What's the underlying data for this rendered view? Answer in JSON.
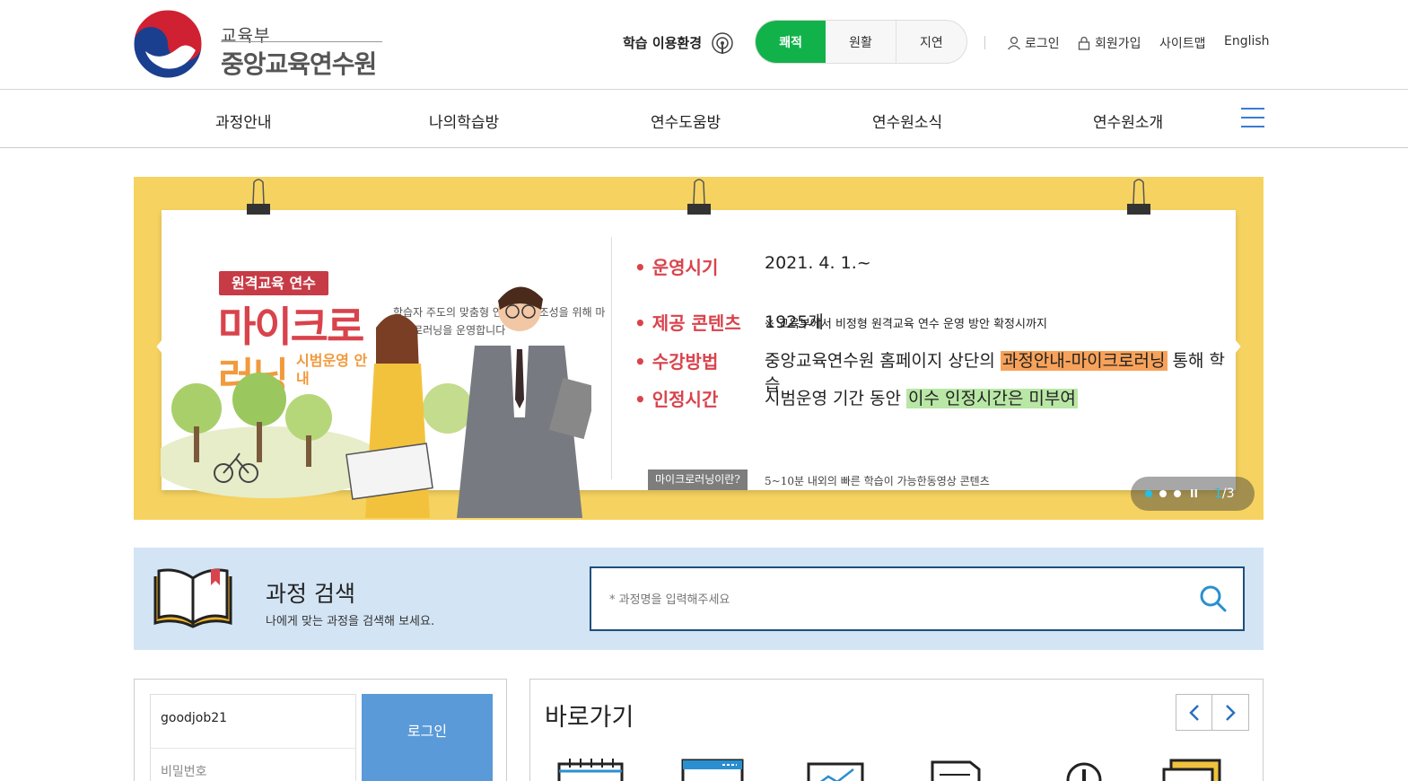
{
  "header": {
    "logo_small": "교육부",
    "logo_big": "중앙교육연수원",
    "env_label": "학습 이용환경",
    "env_options": [
      "쾌적",
      "원활",
      "지연"
    ],
    "env_selected": "쾌적",
    "util": {
      "login": "로그인",
      "signup": "회원가입",
      "sitemap": "사이트맵",
      "english": "English"
    }
  },
  "gnb": {
    "items": [
      "과정안내",
      "나의학습방",
      "연수도움방",
      "연수원소식",
      "연수원소개"
    ]
  },
  "banner": {
    "badge": "원격교육 연수",
    "title_line1": "마이크로",
    "title_line2": "러닝",
    "title_sub": "시범운영 안내",
    "intro": "학습자 주도의 맞춤형 연수 환경 조성을 위해 마이크로러닝을 운영합니다",
    "rows": [
      {
        "label": "운영시기",
        "value": "2021. 4. 1.~"
      },
      {
        "label": "제공 콘텐츠",
        "value": "1925개"
      },
      {
        "label": "수강방법",
        "value_pre": "중앙교육연수원 홈페이지 상단의 ",
        "value_hl": "과정안내-마이크로러닝",
        "value_post": " 통해 학습"
      },
      {
        "label": "인정시간",
        "value_pre": "시범운영 기간 동안 ",
        "value_hl": "이수 인정시간은 미부여"
      }
    ],
    "note": "※ 교육부에서 비정형 원격교육 연수 운영 방안 확정시까지",
    "micro_tag": "마이크로러닝이란?",
    "micro_desc": "5~10분 내외의 빠른 학습이 가능한동영상 콘텐츠",
    "pager": {
      "current": "1",
      "total": "/3",
      "pause": "II"
    },
    "colors": {
      "bg": "#f6d360",
      "red": "#d9434c",
      "orange": "#f29a3c"
    }
  },
  "search": {
    "title": "과정 검색",
    "subtitle": "나에게 맞는 과정을 검색해 보세요.",
    "placeholder": "* 과정명을 입력해주세요"
  },
  "login": {
    "id_value": "goodjob21",
    "pw_placeholder": "비밀번호",
    "button": "로그인"
  },
  "quick": {
    "title": "바로가기",
    "prev": "‹",
    "next": "›"
  }
}
